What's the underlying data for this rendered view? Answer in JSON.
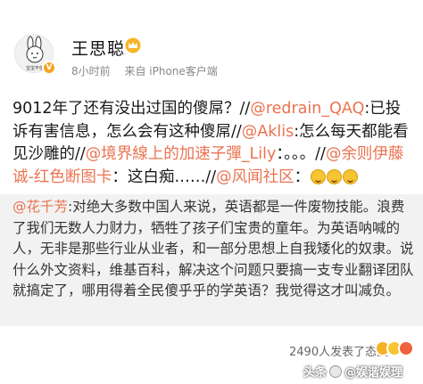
{
  "header": {
    "user_name": "王思聪",
    "time": "8小时前",
    "source": "来自 iPhone客户端",
    "avatar_icon": "rabbit-avatar-icon",
    "avatar_text": "宝宝不信"
  },
  "post": {
    "segments": [
      {
        "text": "9012年了还有没出过国的傻屌？//",
        "type": "text"
      },
      {
        "text": "@redrain_QAQ",
        "type": "mention"
      },
      {
        "text": ":已投诉有害信息，怎么会有这种傻屌//",
        "type": "text"
      },
      {
        "text": "@Aklis",
        "type": "mention"
      },
      {
        "text": ":怎么每天都能看见沙雕的//",
        "type": "text"
      },
      {
        "text": "@境界線上的加速子彈_Lily",
        "type": "mention"
      },
      {
        "text": "：。。。//",
        "type": "text"
      },
      {
        "text": "@余则伊藤诚-红色断图卡",
        "type": "mention"
      },
      {
        "text": "：这白痴……//",
        "type": "text"
      },
      {
        "text": "@风闻社区",
        "type": "mention"
      },
      {
        "text": "：",
        "type": "text"
      }
    ]
  },
  "quote": {
    "author": "@花千芳",
    "text": ":对绝大多数中国人来说，英语都是一件废物技能。浪费了我们无数人力财力，牺牲了孩子们宝贵的童年。为英语呐喊的人，无非是那些行业从业者，和一部分思想上自我矮化的奴隶。说什么外文资料，维基百科，解决这个问题只要搞一支专业翻译团队就搞定了，哪用得着全民傻乎乎的学英语？我觉得这才叫减负。"
  },
  "footer": {
    "reactions_text": "2490人发表了态度"
  },
  "watermark": {
    "prefix": "头条",
    "account": "@娱谐娱理"
  },
  "colors": {
    "mention": "#eb7350",
    "quote_bg": "#f2f2f2"
  }
}
